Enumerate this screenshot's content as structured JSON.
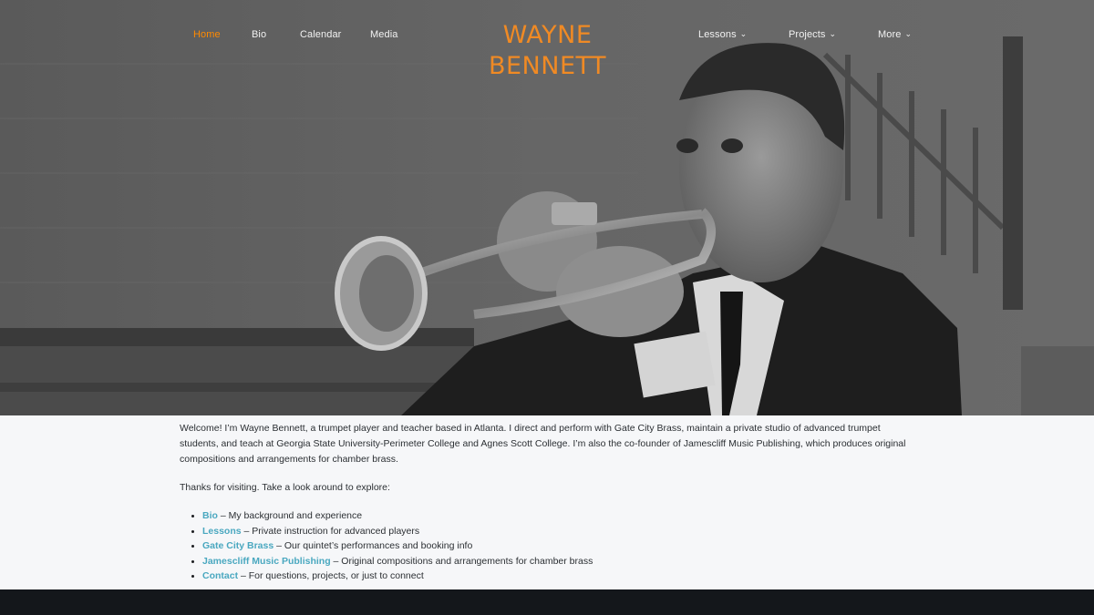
{
  "site": {
    "logo": "WAYNE BENNETT",
    "accent_color": "#ff8a00",
    "link_color": "#4aa8c0",
    "footer_color": "#14171b"
  },
  "nav": {
    "home": "Home",
    "bio": "Bio",
    "calendar": "Calendar",
    "media": "Media",
    "lessons": "Lessons",
    "projects": "Projects",
    "more": "More",
    "dropdown_icon": "chevron-down-icon"
  },
  "hero": {
    "image": "trumpet-player-photo"
  },
  "main": {
    "intro": "Welcome! I’m Wayne Bennett, a trumpet player and teacher based in Atlanta. I direct and perform with Gate City Brass, maintain a private studio of advanced trumpet students, and teach at Georgia State University-Perimeter College and Agnes Scott College. I’m also the co-founder of Jamescliff Music Publishing, which produces original compositions and arrangements for chamber brass.",
    "thanks": "Thanks for visiting. Take a look around to explore:",
    "links": [
      {
        "label": "Bio",
        "desc": " – My background and experience"
      },
      {
        "label": "Lessons",
        "desc": " – Private instruction for advanced players"
      },
      {
        "label": "Gate City Brass",
        "desc": " – Our quintet’s performances and booking info"
      },
      {
        "label": "Jamescliff Music Publishing",
        "desc": " – Original compositions and arrangements for chamber brass"
      },
      {
        "label": "Contact",
        "desc": " – For questions, projects, or just to connect"
      }
    ]
  }
}
